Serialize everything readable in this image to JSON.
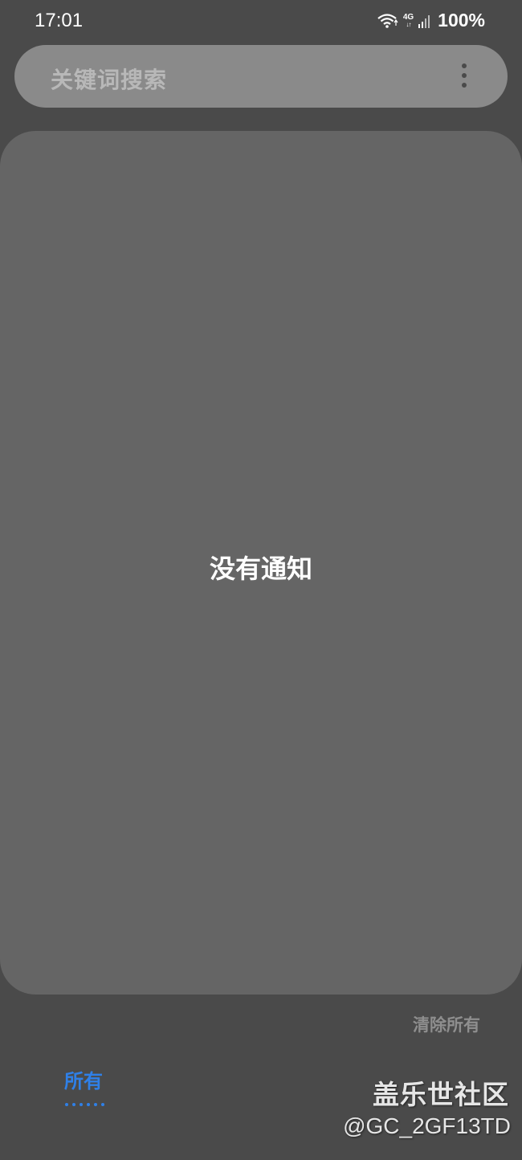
{
  "status_bar": {
    "time": "17:01",
    "network_type": "4G",
    "network_arrows": "↓↑",
    "battery": "100%",
    "icons": [
      "wifi-icon",
      "signal-icon"
    ]
  },
  "search": {
    "placeholder": "关键词搜索",
    "menu_icon": "more-vertical-icon"
  },
  "notifications": {
    "empty_message": "没有通知"
  },
  "actions": {
    "clear_all": "清除所有"
  },
  "tabs": [
    {
      "label": "所有",
      "selected": true
    }
  ],
  "watermark": {
    "title": "盖乐世社区",
    "handle": "@GC_2GF13TD"
  },
  "colors": {
    "background": "#4a4a4a",
    "search_bar": "#8a8a8a",
    "panel": "#656565",
    "accent": "#2f80e8"
  }
}
